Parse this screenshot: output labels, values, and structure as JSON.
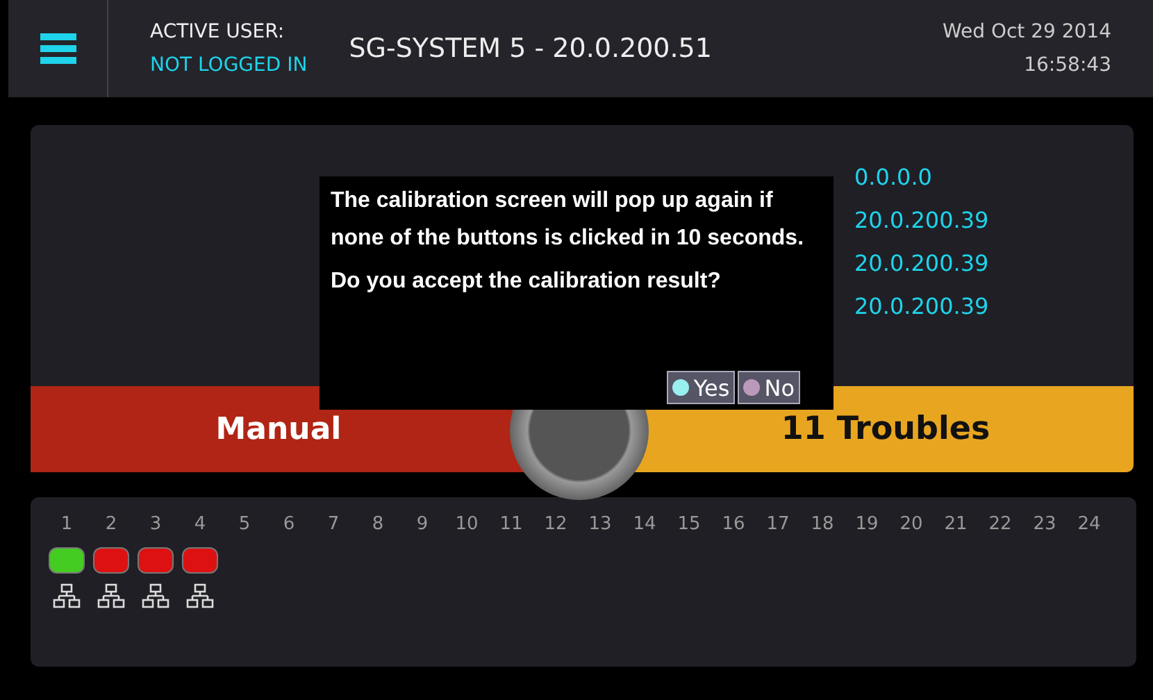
{
  "header": {
    "active_user_label": "ACTIVE USER:",
    "active_user": "NOT LOGGED IN",
    "system": "SG-SYSTEM 5  -  20.0.200.51",
    "date": "Wed Oct 29 2014",
    "time": "16:58:43"
  },
  "info": {
    "values": [
      "0.0.0.0",
      "20.0.200.39",
      "20.0.200.39",
      "20.0.200.39"
    ]
  },
  "mode_bar": {
    "left": "Manual",
    "right": "11 Troubles"
  },
  "dialog": {
    "message": "The calibration screen will pop up again if none of the buttons is clicked in 10 seconds.",
    "question": "Do you accept the calibration result?",
    "buttons": [
      "Yes",
      "No"
    ]
  },
  "ports": [
    {
      "label": "1",
      "color": "#44cc22",
      "linked": true
    },
    {
      "label": "2",
      "color": "#dd1111",
      "linked": true
    },
    {
      "label": "3",
      "color": "#dd1111",
      "linked": true
    },
    {
      "label": "4",
      "color": "#dd1111",
      "linked": true
    },
    {
      "label": "5",
      "linked": false
    },
    {
      "label": "6",
      "linked": false
    },
    {
      "label": "7",
      "linked": false
    },
    {
      "label": "8",
      "linked": false
    },
    {
      "label": "9",
      "linked": false
    },
    {
      "label": "10",
      "linked": false
    },
    {
      "label": "11",
      "linked": false
    },
    {
      "label": "12",
      "linked": false
    },
    {
      "label": "13",
      "linked": false
    },
    {
      "label": "14",
      "linked": false
    },
    {
      "label": "15",
      "linked": false
    },
    {
      "label": "16",
      "linked": false
    },
    {
      "label": "17",
      "linked": false
    },
    {
      "label": "18",
      "linked": false
    },
    {
      "label": "19",
      "linked": false
    },
    {
      "label": "20",
      "linked": false
    },
    {
      "label": "21",
      "linked": false
    },
    {
      "label": "22",
      "linked": false
    },
    {
      "label": "23",
      "linked": false
    },
    {
      "label": "24",
      "linked": false
    }
  ]
}
